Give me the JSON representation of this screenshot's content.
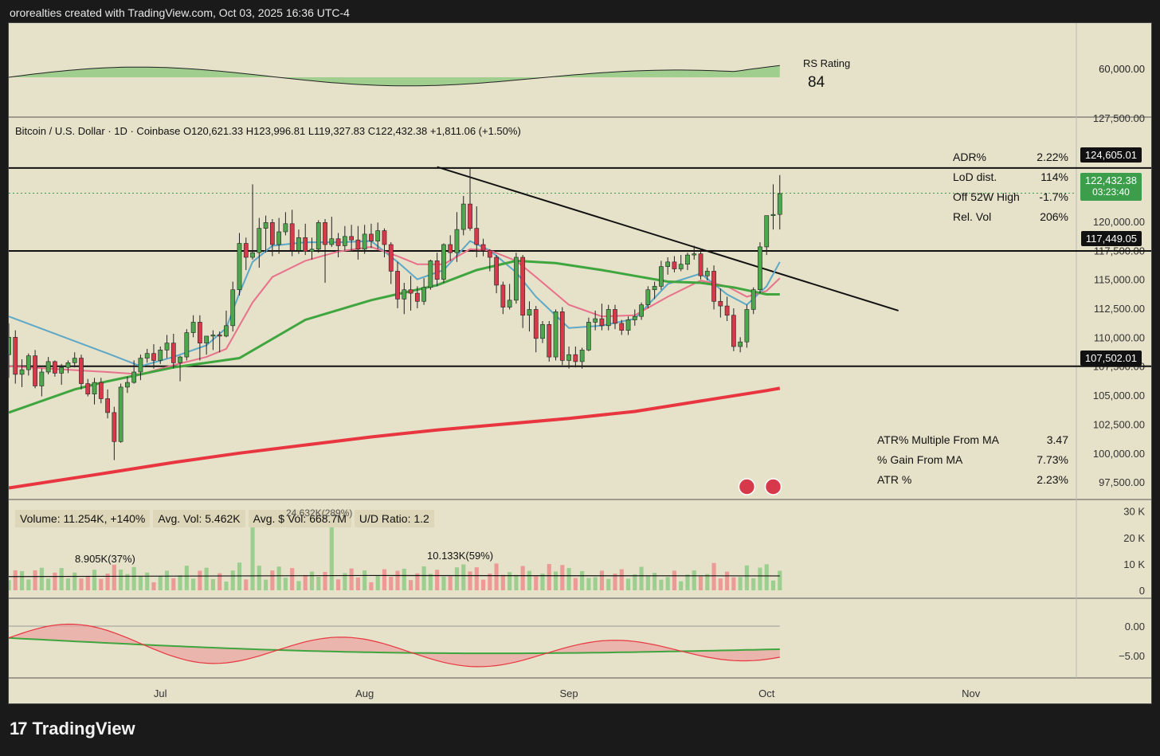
{
  "header": {
    "credit": "ororealties created with TradingView.com, Oct 03, 2025 16:36 UTC-4"
  },
  "brand": {
    "name": "TradingView"
  },
  "instrument_line": "Bitcoin / U.S. Dollar · 1D · Coinbase  O120,621.33  H123,996.81  L119,327.83  C122,432.38  +1,811.06 (+1.50%)",
  "rs": {
    "label": "RS Rating",
    "value": "84",
    "axis_tick": "60,000.00"
  },
  "stats_top": [
    {
      "label": "ADR%",
      "value": "2.22%"
    },
    {
      "label": "LoD dist.",
      "value": "114%"
    },
    {
      "label": "Off 52W High",
      "value": "-1.7%"
    },
    {
      "label": "Rel. Vol",
      "value": "206%"
    }
  ],
  "stats_bottom": [
    {
      "label": "ATR% Multiple From MA",
      "value": "3.47"
    },
    {
      "label": "% Gain From MA",
      "value": "7.73%"
    },
    {
      "label": "ATR %",
      "value": "2.23%"
    }
  ],
  "price_tags": {
    "high_level": "124,605.01",
    "last": "122,432.38",
    "countdown": "03:23:40",
    "mid_level": "117,449.05",
    "low_level": "107,502.01",
    "clipped_tick": "127,500.00"
  },
  "volume_pane": {
    "volume": "Volume: 11.254K, +140%",
    "avg_vol": "Avg. Vol: 5.462K",
    "avg_dollar_vol": "Avg. $ Vol: 668.7M",
    "ud_ratio": "U/D Ratio: 1.2",
    "callout_1": "24.632K(289%)",
    "callout_2": "8.905K(37%)",
    "callout_3": "10.133K(59%)",
    "ticks": [
      "30 K",
      "20 K",
      "10 K",
      "0"
    ]
  },
  "osc_pane": {
    "ticks": [
      "0.00",
      "−5.00"
    ]
  },
  "chart_data": {
    "type": "candlestick",
    "y_ticks": [
      "120,000.00",
      "117,500.00",
      "115,000.00",
      "112,500.00",
      "110,000.00",
      "107,500.00",
      "105,000.00",
      "102,500.00",
      "100,000.00",
      "97,500.00"
    ],
    "y_tick_values": [
      120000,
      117500,
      115000,
      112500,
      110000,
      107500,
      105000,
      102500,
      100000,
      97500
    ],
    "ylim": [
      96000,
      129000
    ],
    "x_labels": [
      "Jul",
      "Aug",
      "Sep",
      "Oct",
      "Nov"
    ],
    "x_label_days": [
      8,
      39,
      70,
      100,
      131
    ],
    "x_range_days": [
      -15,
      147
    ],
    "last_day": 102,
    "horizontal_levels": [
      124605.01,
      117449.05,
      107502.01
    ],
    "trendline": {
      "from": [
        50,
        124700
      ],
      "to": [
        120,
        112300
      ]
    },
    "candles": [
      [
        -15,
        108500,
        111200,
        106500,
        110000
      ],
      [
        -14,
        110000,
        110600,
        106000,
        106800
      ],
      [
        -13,
        106800,
        108100,
        105700,
        107200
      ],
      [
        -12,
        107200,
        108600,
        106700,
        108400
      ],
      [
        -11,
        108400,
        108900,
        105600,
        105800
      ],
      [
        -10,
        105800,
        107300,
        104900,
        107000
      ],
      [
        -9,
        107000,
        108300,
        106800,
        107900
      ],
      [
        -8,
        107900,
        108000,
        106600,
        106900
      ],
      [
        -7,
        106900,
        107700,
        105900,
        107400
      ],
      [
        -6,
        107400,
        108000,
        106900,
        107800
      ],
      [
        -5,
        107800,
        108700,
        107400,
        108200
      ],
      [
        -4,
        108200,
        108500,
        105500,
        106000
      ],
      [
        -3,
        106000,
        106400,
        104900,
        105100
      ],
      [
        -2,
        105100,
        106500,
        104200,
        106100
      ],
      [
        -1,
        106100,
        106500,
        104300,
        104700
      ],
      [
        0,
        104700,
        105500,
        103000,
        103500
      ],
      [
        1,
        103500,
        104000,
        99400,
        101000
      ],
      [
        2,
        101000,
        106000,
        100900,
        105700
      ],
      [
        3,
        105700,
        106600,
        105200,
        106100
      ],
      [
        4,
        106100,
        108000,
        106000,
        107000
      ],
      [
        5,
        107000,
        108500,
        106300,
        108200
      ],
      [
        6,
        108200,
        109000,
        107800,
        108600
      ],
      [
        7,
        108600,
        109400,
        107300,
        108000
      ],
      [
        8,
        108000,
        109200,
        107700,
        108900
      ],
      [
        9,
        108900,
        110200,
        108200,
        109500
      ],
      [
        10,
        109500,
        110300,
        107300,
        107800
      ],
      [
        11,
        107800,
        108400,
        106200,
        108300
      ],
      [
        12,
        108300,
        110700,
        108000,
        110400
      ],
      [
        13,
        110400,
        111900,
        110000,
        111300
      ],
      [
        14,
        111300,
        111900,
        108000,
        109500
      ],
      [
        15,
        109500,
        110100,
        108500,
        110100
      ],
      [
        16,
        110100,
        110600,
        108900,
        110200
      ],
      [
        17,
        110200,
        110500,
        108700,
        110100
      ],
      [
        18,
        110100,
        112300,
        110000,
        111000
      ],
      [
        19,
        111000,
        114800,
        110500,
        114100
      ],
      [
        20,
        114100,
        119000,
        113600,
        118100
      ],
      [
        21,
        118100,
        118600,
        115800,
        116900
      ],
      [
        22,
        116900,
        123200,
        116700,
        117300
      ],
      [
        23,
        117300,
        120300,
        116000,
        119400
      ],
      [
        24,
        119400,
        120500,
        117300,
        119900
      ],
      [
        25,
        119900,
        120200,
        117000,
        118000
      ],
      [
        26,
        118000,
        120300,
        117200,
        119100
      ],
      [
        27,
        119100,
        120800,
        118800,
        119800
      ],
      [
        28,
        119800,
        121000,
        117000,
        117500
      ],
      [
        29,
        117500,
        119300,
        117200,
        118600
      ],
      [
        30,
        118600,
        119800,
        117100,
        117400
      ],
      [
        31,
        117400,
        118600,
        116700,
        117600
      ],
      [
        32,
        117600,
        120100,
        117300,
        119900
      ],
      [
        33,
        119900,
        120200,
        114700,
        118000
      ],
      [
        34,
        118000,
        120400,
        117800,
        118500
      ],
      [
        35,
        118500,
        119000,
        116900,
        117900
      ],
      [
        36,
        117900,
        119600,
        117500,
        118700
      ],
      [
        37,
        118700,
        119700,
        117400,
        118400
      ],
      [
        38,
        118400,
        119600,
        116700,
        117600
      ],
      [
        39,
        117600,
        119700,
        117200,
        118900
      ],
      [
        40,
        118900,
        119800,
        117700,
        118300
      ],
      [
        41,
        118300,
        119900,
        117600,
        119200
      ],
      [
        42,
        119200,
        119400,
        116900,
        118000
      ],
      [
        43,
        118000,
        118200,
        114600,
        115700
      ],
      [
        44,
        115700,
        116500,
        112500,
        113300
      ],
      [
        45,
        113300,
        114700,
        112000,
        114100
      ],
      [
        46,
        114100,
        115300,
        112300,
        113800
      ],
      [
        47,
        113800,
        114400,
        112500,
        113100
      ],
      [
        48,
        113100,
        115100,
        112800,
        114300
      ],
      [
        49,
        114300,
        116700,
        114100,
        116600
      ],
      [
        50,
        116600,
        117300,
        114400,
        115000
      ],
      [
        51,
        115000,
        118100,
        114700,
        118000
      ],
      [
        52,
        118000,
        118800,
        116600,
        117300
      ],
      [
        53,
        117300,
        120800,
        116500,
        119300
      ],
      [
        54,
        119300,
        122200,
        118800,
        121500
      ],
      [
        55,
        121500,
        124600,
        119200,
        119400
      ],
      [
        56,
        119400,
        121300,
        116900,
        118000
      ],
      [
        57,
        118000,
        118500,
        117000,
        117500
      ],
      [
        58,
        117500,
        117600,
        115700,
        116900
      ],
      [
        59,
        116900,
        117100,
        113800,
        114500
      ],
      [
        60,
        114500,
        114800,
        112000,
        112600
      ],
      [
        61,
        112600,
        114600,
        112400,
        113200
      ],
      [
        62,
        113200,
        117300,
        112900,
        116900
      ],
      [
        63,
        116900,
        117100,
        110800,
        111900
      ],
      [
        64,
        111900,
        113100,
        110500,
        112400
      ],
      [
        65,
        112400,
        112700,
        108700,
        109900
      ],
      [
        66,
        109900,
        111400,
        109500,
        111100
      ],
      [
        67,
        111100,
        111400,
        107900,
        108300
      ],
      [
        68,
        108300,
        112400,
        108000,
        112200
      ],
      [
        69,
        112200,
        112600,
        107600,
        108000
      ],
      [
        70,
        108000,
        109200,
        107300,
        108500
      ],
      [
        71,
        108500,
        109200,
        107400,
        107900
      ],
      [
        72,
        107900,
        109100,
        107300,
        108900
      ],
      [
        73,
        108900,
        111700,
        108800,
        111300
      ],
      [
        74,
        111300,
        112300,
        110600,
        111600
      ],
      [
        75,
        111600,
        112900,
        110600,
        111000
      ],
      [
        76,
        111000,
        112800,
        110600,
        112400
      ],
      [
        77,
        112400,
        112800,
        110700,
        111200
      ],
      [
        78,
        111200,
        111500,
        110200,
        110600
      ],
      [
        79,
        110600,
        111800,
        110200,
        111500
      ],
      [
        80,
        111500,
        112400,
        111000,
        111800
      ],
      [
        81,
        111800,
        113000,
        111500,
        112800
      ],
      [
        82,
        112800,
        114400,
        112500,
        114100
      ],
      [
        83,
        114100,
        114800,
        113300,
        114400
      ],
      [
        84,
        114400,
        116600,
        114100,
        116100
      ],
      [
        85,
        116100,
        116900,
        115400,
        116500
      ],
      [
        86,
        116500,
        117000,
        115600,
        115900
      ],
      [
        87,
        115900,
        117100,
        115700,
        116300
      ],
      [
        88,
        116300,
        117300,
        115800,
        117100
      ],
      [
        89,
        117100,
        117900,
        116700,
        117200
      ],
      [
        90,
        117200,
        117600,
        115000,
        115300
      ],
      [
        91,
        115300,
        116000,
        114900,
        115700
      ],
      [
        92,
        115700,
        116200,
        112400,
        113100
      ],
      [
        93,
        113100,
        114200,
        111700,
        112700
      ],
      [
        94,
        112700,
        113500,
        111400,
        111900
      ],
      [
        95,
        111900,
        112500,
        108800,
        109200
      ],
      [
        96,
        109200,
        110000,
        108700,
        109600
      ],
      [
        97,
        109600,
        112800,
        109100,
        112400
      ],
      [
        98,
        112400,
        114300,
        112000,
        114100
      ],
      [
        99,
        114100,
        118200,
        113800,
        117800
      ],
      [
        100,
        117800,
        120400,
        117100,
        120500
      ],
      [
        101,
        120500,
        123200,
        119300,
        120600
      ],
      [
        102,
        120600,
        124000,
        119300,
        122400
      ]
    ],
    "series": [
      {
        "name": "",
        "color": "#5ea8c7",
        "values": [
          [
            -15,
            111800
          ],
          [
            0,
            108600
          ],
          [
            5,
            107500
          ],
          [
            10,
            108300
          ],
          [
            15,
            109300
          ],
          [
            18,
            110800
          ],
          [
            20,
            113800
          ],
          [
            22,
            116500
          ],
          [
            25,
            117900
          ],
          [
            30,
            118200
          ],
          [
            35,
            118200
          ],
          [
            40,
            118300
          ],
          [
            44,
            116500
          ],
          [
            47,
            115000
          ],
          [
            51,
            115800
          ],
          [
            55,
            118300
          ],
          [
            58,
            117500
          ],
          [
            62,
            115600
          ],
          [
            65,
            113500
          ],
          [
            70,
            110800
          ],
          [
            75,
            111000
          ],
          [
            80,
            111600
          ],
          [
            85,
            114600
          ],
          [
            90,
            115500
          ],
          [
            94,
            113700
          ],
          [
            97,
            112800
          ],
          [
            100,
            114400
          ],
          [
            102,
            116500
          ]
        ]
      },
      {
        "name": "",
        "color": "#e8728c",
        "values": [
          [
            -15,
            107500
          ],
          [
            0,
            107000
          ],
          [
            5,
            106800
          ],
          [
            10,
            107600
          ],
          [
            15,
            108300
          ],
          [
            18,
            109000
          ],
          [
            20,
            111000
          ],
          [
            22,
            113000
          ],
          [
            25,
            115200
          ],
          [
            30,
            116600
          ],
          [
            35,
            117400
          ],
          [
            40,
            117800
          ],
          [
            44,
            117000
          ],
          [
            47,
            116300
          ],
          [
            51,
            116300
          ],
          [
            55,
            117600
          ],
          [
            58,
            117500
          ],
          [
            62,
            116600
          ],
          [
            65,
            115200
          ],
          [
            70,
            112800
          ],
          [
            75,
            111800
          ],
          [
            80,
            111900
          ],
          [
            85,
            113500
          ],
          [
            90,
            114900
          ],
          [
            94,
            114400
          ],
          [
            97,
            113500
          ],
          [
            100,
            114000
          ],
          [
            102,
            115100
          ]
        ]
      },
      {
        "name": "",
        "color": "#3fa63f",
        "values": [
          [
            -15,
            103500
          ],
          [
            -5,
            105500
          ],
          [
            0,
            106200
          ],
          [
            10,
            107400
          ],
          [
            20,
            108200
          ],
          [
            30,
            111500
          ],
          [
            40,
            113200
          ],
          [
            50,
            114500
          ],
          [
            56,
            115800
          ],
          [
            62,
            116600
          ],
          [
            68,
            116400
          ],
          [
            75,
            115800
          ],
          [
            80,
            115300
          ],
          [
            85,
            114800
          ],
          [
            90,
            114700
          ],
          [
            95,
            114300
          ],
          [
            100,
            113700
          ],
          [
            102,
            113700
          ]
        ]
      },
      {
        "name": "",
        "color": "#e8353f",
        "values": [
          [
            -15,
            97000
          ],
          [
            0,
            98300
          ],
          [
            10,
            99200
          ],
          [
            20,
            100000
          ],
          [
            30,
            100700
          ],
          [
            40,
            101400
          ],
          [
            50,
            102000
          ],
          [
            60,
            102500
          ],
          [
            70,
            103000
          ],
          [
            80,
            103600
          ],
          [
            90,
            104500
          ],
          [
            100,
            105400
          ],
          [
            102,
            105600
          ]
        ]
      }
    ]
  }
}
